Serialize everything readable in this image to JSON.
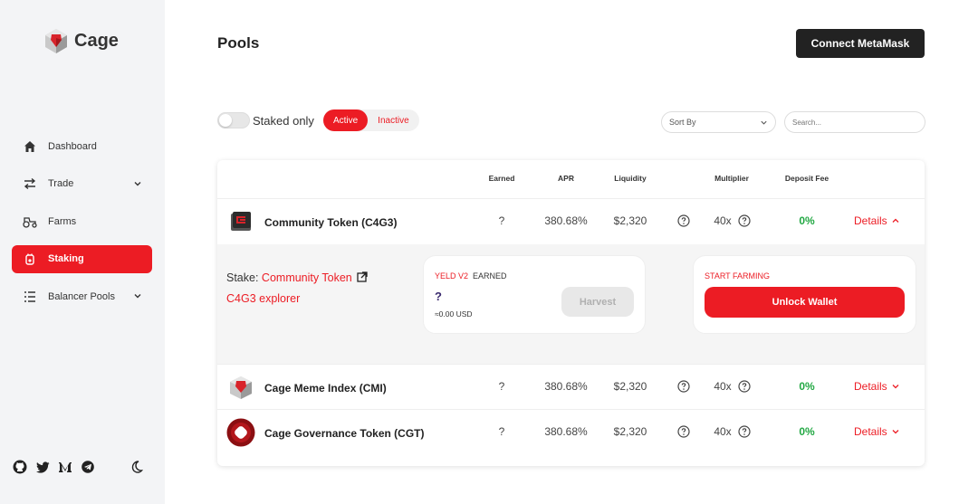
{
  "app": {
    "name": "Cage"
  },
  "sidebar": {
    "items": [
      {
        "label": "Dashboard",
        "icon": "home-icon"
      },
      {
        "label": "Trade",
        "icon": "swap-icon"
      },
      {
        "label": "Farms",
        "icon": "tractor-icon"
      },
      {
        "label": "Staking",
        "icon": "staking-icon",
        "active": true
      },
      {
        "label": "Balancer Pools",
        "icon": "list-icon"
      }
    ],
    "social": [
      "github-icon",
      "twitter-icon",
      "medium-icon",
      "telegram-icon"
    ],
    "theme_icon": "moon-icon"
  },
  "header": {
    "title": "Pools",
    "connect_label": "Connect MetaMask"
  },
  "filters": {
    "staked_only_label": "Staked only",
    "active_label": "Active",
    "inactive_label": "Inactive",
    "sort_label": "Sort By",
    "search_placeholder": "Search..."
  },
  "table": {
    "columns": [
      "Earned",
      "APR",
      "Liquidity",
      "Multiplier",
      "Deposit Fee"
    ],
    "rows": [
      {
        "name": "Community Token (C4G3)",
        "earned": "?",
        "apr": "380.68%",
        "liquidity": "$2,320",
        "multiplier": "40x",
        "fee": "0%",
        "details": "Details",
        "expanded": true
      },
      {
        "name": "Cage Meme Index (CMI)",
        "earned": "?",
        "apr": "380.68%",
        "liquidity": "$2,320",
        "multiplier": "40x",
        "fee": "0%",
        "details": "Details"
      },
      {
        "name": "Cage Governance Token (CGT)",
        "earned": "?",
        "apr": "380.68%",
        "liquidity": "$2,320",
        "multiplier": "40x",
        "fee": "0%",
        "details": "Details"
      }
    ]
  },
  "expanded": {
    "stake_prefix": "Stake:",
    "stake_link": "Community Token",
    "explorer": "C4G3 explorer",
    "earned_token": "YELD V2",
    "earned_label": "EARNED",
    "earned_value": "?",
    "earned_usd": "≈0.00 USD",
    "harvest_label": "Harvest",
    "farming_label": "START FARMING",
    "unlock_label": "Unlock Wallet"
  },
  "colors": {
    "accent": "#ec1c24",
    "positive": "#22a843",
    "dark": "#222222"
  }
}
